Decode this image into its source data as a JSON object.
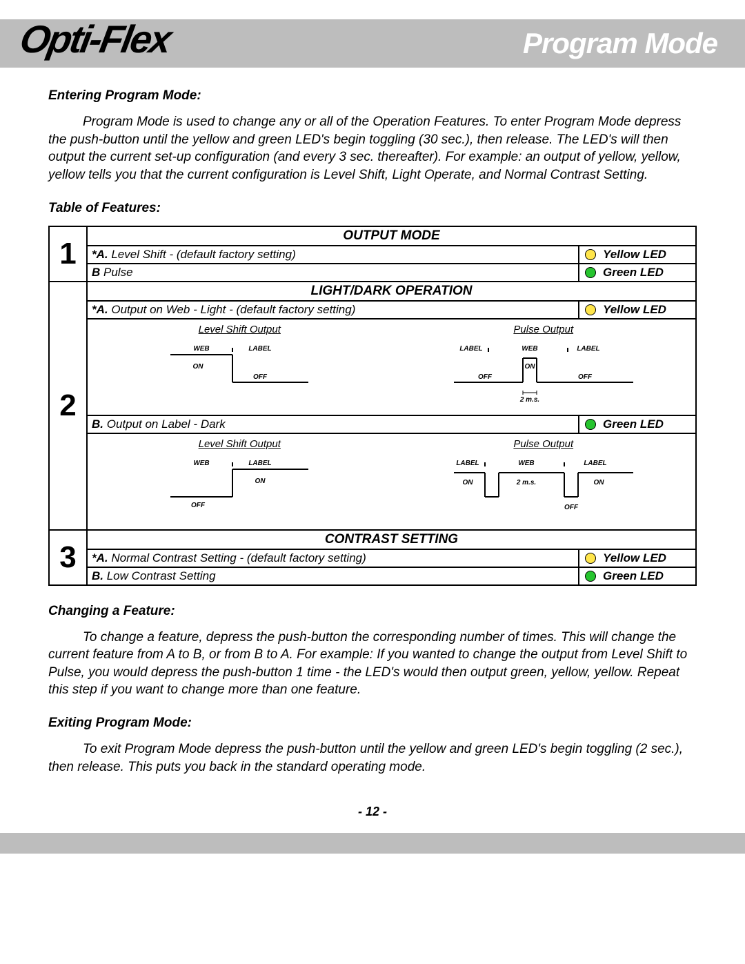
{
  "header": {
    "logo_text": "Opti-Flex",
    "title": "Program Mode"
  },
  "entering": {
    "heading": "Entering Program Mode:",
    "body": "Program Mode is used to change any or all of the Operation Features. To enter Program Mode depress the push-button until the yellow and green LED's begin toggling (30 sec.), then release. The LED's will then output the current set-up configuration (and every 3 sec. thereafter). For example: an output of yellow, yellow, yellow tells you that the current configuration is Level Shift, Light Operate, and Normal Contrast Setting."
  },
  "table_heading": "Table of Features:",
  "features": {
    "row1": {
      "num": "1",
      "category": "OUTPUT MODE",
      "a_prefix": "*A.",
      "a_text": " Level Shift - (default factory setting)",
      "a_led": "Yellow LED",
      "b_prefix": "B",
      "b_text": " Pulse",
      "b_led": "Green LED"
    },
    "row2": {
      "num": "2",
      "category": "LIGHT/DARK OPERATION",
      "a_prefix": "*A.",
      "a_text": " Output on Web - Light - (default factory setting)",
      "a_led": "Yellow LED",
      "b_prefix": "B.",
      "b_text": " Output on Label - Dark",
      "b_led": "Green LED",
      "diag": {
        "left_title": "Level Shift Output",
        "right_title": "Pulse Output",
        "web": "WEB",
        "label": "LABEL",
        "on": "ON",
        "off": "OFF",
        "pulse": "2 m.s."
      }
    },
    "row3": {
      "num": "3",
      "category": "CONTRAST SETTING",
      "a_prefix": "*A.",
      "a_text": " Normal Contrast Setting - (default factory setting)",
      "a_led": "Yellow LED",
      "b_prefix": "B.",
      "b_text": " Low Contrast Setting",
      "b_led": "Green LED"
    }
  },
  "changing": {
    "heading": "Changing a Feature:",
    "body": "To change a feature, depress the push-button the corresponding number of times. This will change the current feature from A to B, or from B to A. For example: If you wanted to change the output from Level Shift to Pulse, you would depress the push-button 1 time - the LED's would then output green, yellow, yellow. Repeat this step if you want to change more than one feature."
  },
  "exiting": {
    "heading": "Exiting Program Mode:",
    "body": "To exit Program Mode depress the push-button until the yellow and green LED's begin toggling (2 sec.), then release. This puts you back in the standard operating mode."
  },
  "page_number": "- 12 -"
}
